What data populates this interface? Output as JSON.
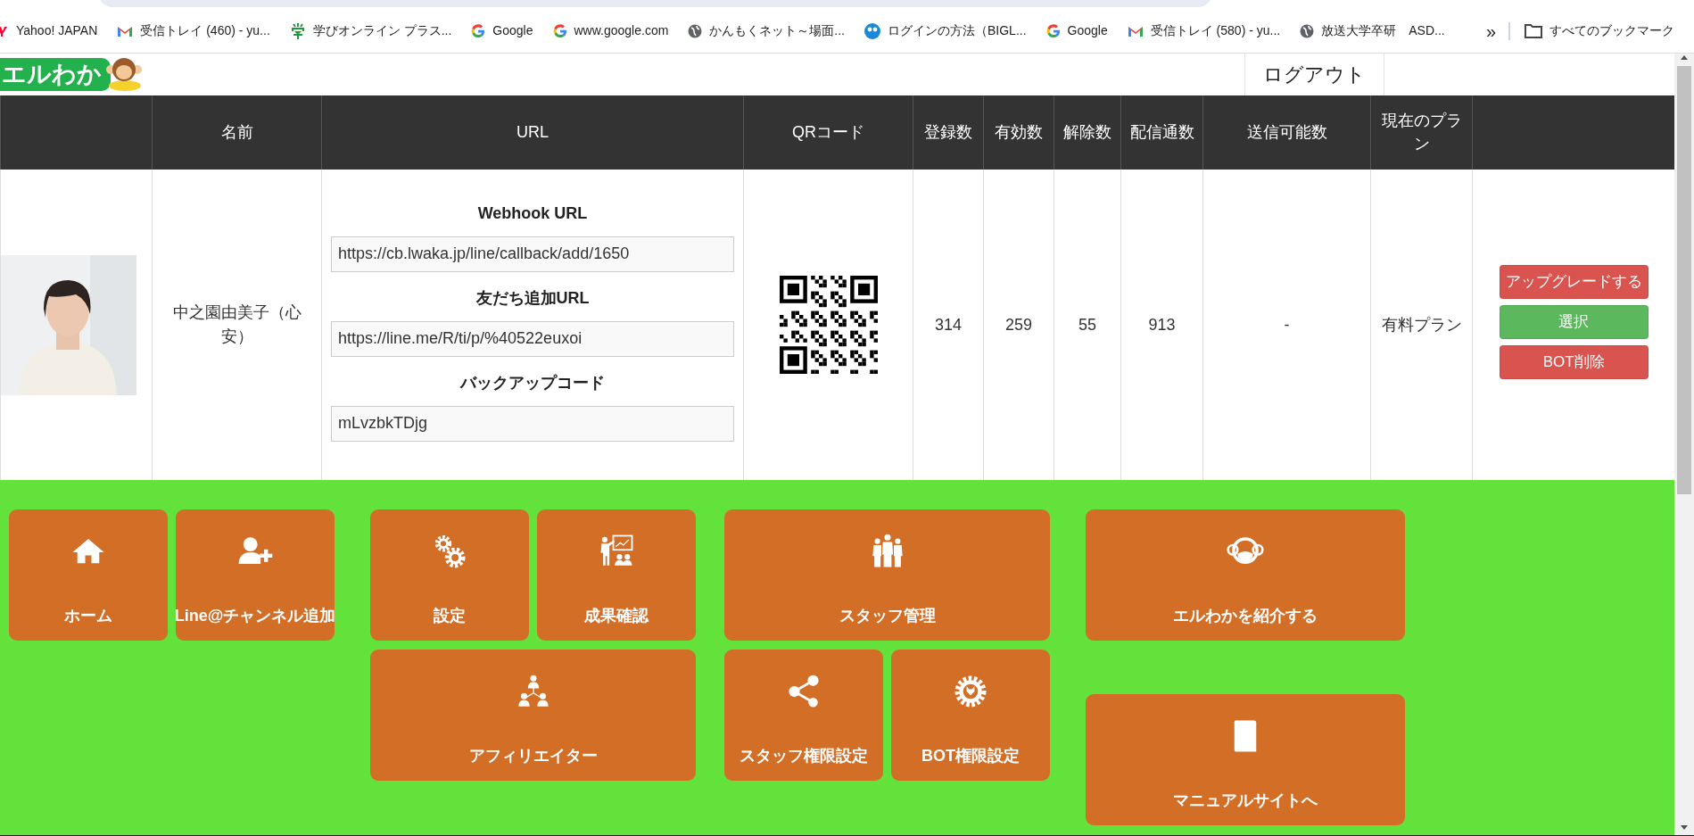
{
  "bookmarks": [
    {
      "label": "Yahoo! JAPAN"
    },
    {
      "label": "受信トレイ (460) - yu..."
    },
    {
      "label": "学びオンライン プラス..."
    },
    {
      "label": "Google"
    },
    {
      "label": "www.google.com"
    },
    {
      "label": "かんもくネット～場面..."
    },
    {
      "label": "ログインの方法（BIGL..."
    },
    {
      "label": "Google"
    },
    {
      "label": "受信トレイ (580) - yu..."
    },
    {
      "label": "放送大学卒研　ASD..."
    }
  ],
  "bookmarks_more": "»",
  "all_bookmarks": "すべてのブックマーク",
  "logo": {
    "text": "エルわか"
  },
  "logout_button": "ログアウト",
  "table": {
    "columns": [
      {
        "label": "名前"
      },
      {
        "label": "URL"
      },
      {
        "label": "QRコード"
      },
      {
        "label": "登録数"
      },
      {
        "label": "有効数"
      },
      {
        "label": "解除数"
      },
      {
        "label": "配信通数"
      },
      {
        "label": "送信可能数"
      },
      {
        "label": "現在のプラン"
      }
    ],
    "rows": [
      {
        "name": "中之園由美子（心安）",
        "urls": [
          {
            "label": "Webhook URL",
            "value": "https://cb.lwaka.jp/line/callback/add/1650"
          },
          {
            "label": "友だち追加URL",
            "value": "https://line.me/R/ti/p/%40522euxoi"
          },
          {
            "label": "バックアップコード",
            "value": "mLvzbkTDjg"
          }
        ],
        "stats": [
          "314",
          "259",
          "55",
          "913",
          "-"
        ],
        "plan": "有料プラン",
        "actions": [
          {
            "label": "アップグレードする",
            "kind": "danger"
          },
          {
            "label": "選択",
            "kind": "success"
          },
          {
            "label": "BOT削除",
            "kind": "danger"
          }
        ]
      }
    ]
  },
  "menu_groups": [
    {
      "tiles": [
        {
          "label": "ホーム"
        },
        {
          "label": "Line@チャンネル追加"
        }
      ]
    },
    {
      "tiles": [
        {
          "label": "設定"
        },
        {
          "label": "成果確認"
        },
        {
          "label": "アフィリエイター"
        }
      ]
    },
    {
      "tiles": [
        {
          "label": "スタッフ管理"
        },
        {
          "label": "スタッフ権限設定"
        },
        {
          "label": "BOT権限設定"
        }
      ]
    },
    {
      "tiles": [
        {
          "label": "エルわかを紹介する"
        },
        {
          "label": "マニュアルサイトへ"
        }
      ]
    }
  ]
}
